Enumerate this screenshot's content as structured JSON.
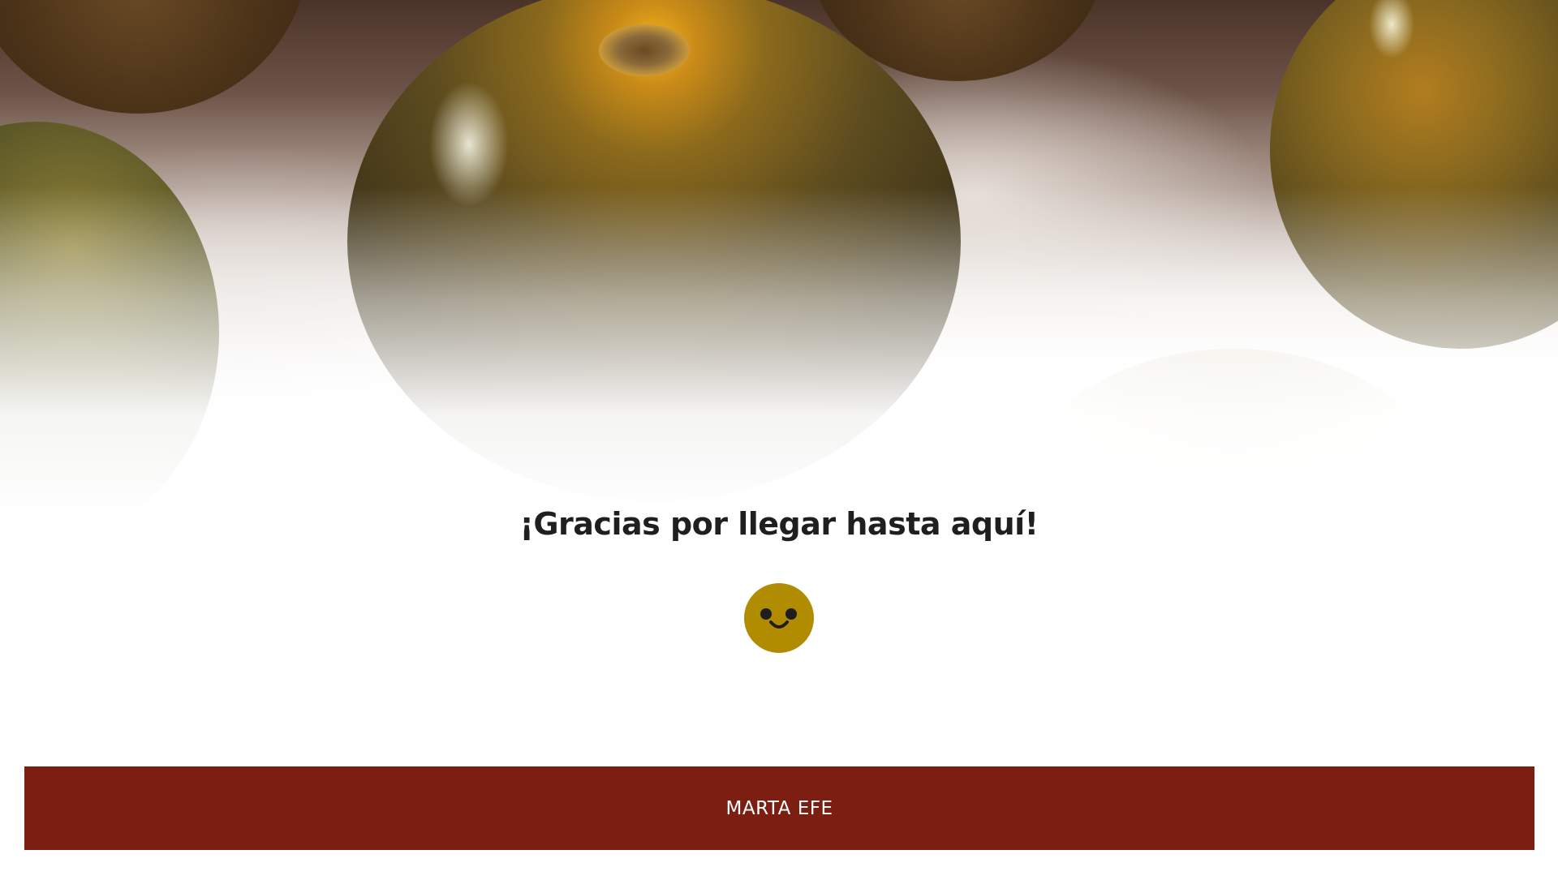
{
  "hero": {
    "image_description_icon": "tomatoes-photo"
  },
  "main": {
    "heading": "¡Gracias por llegar hasta aquí!",
    "emoji_icon": "smiley-face-icon"
  },
  "footer": {
    "label": "MARTA EFE"
  },
  "colors": {
    "footer_bg": "#7d1e12",
    "smiley_bg": "#b28c00",
    "heading_text": "#1f1f1f"
  }
}
